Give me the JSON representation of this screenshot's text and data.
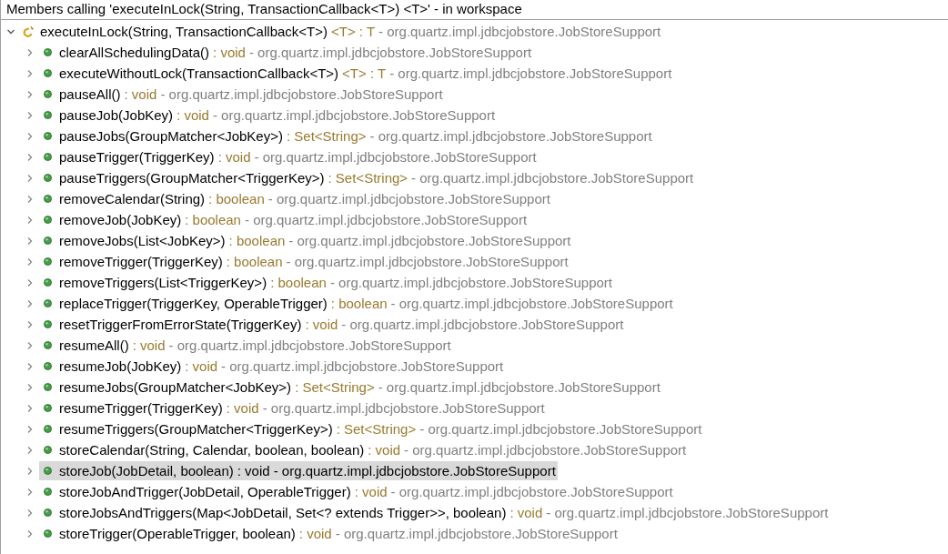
{
  "view": {
    "title": "Members calling 'executeInLock(String, TransactionCallback<T>) <T>' - in workspace"
  },
  "tree": {
    "root": {
      "kind": "generic",
      "name": "executeInLock(String, TransactionCallback<T>)",
      "return_type": "<T> : T",
      "declaring_type": "- org.quartz.impl.jdbcjobstore.JobStoreSupport",
      "expanded": true,
      "selected": false,
      "children": [
        {
          "kind": "public",
          "name": "clearAllSchedulingData()",
          "return_type": ": void",
          "declaring_type": "- org.quartz.impl.jdbcjobstore.JobStoreSupport",
          "expanded": false,
          "selected": false
        },
        {
          "kind": "public",
          "name": "executeWithoutLock(TransactionCallback<T>)",
          "return_type": "<T> : T",
          "declaring_type": "- org.quartz.impl.jdbcjobstore.JobStoreSupport",
          "expanded": false,
          "selected": false
        },
        {
          "kind": "public",
          "name": "pauseAll()",
          "return_type": ": void",
          "declaring_type": "- org.quartz.impl.jdbcjobstore.JobStoreSupport",
          "expanded": false,
          "selected": false
        },
        {
          "kind": "public",
          "name": "pauseJob(JobKey)",
          "return_type": ": void",
          "declaring_type": "- org.quartz.impl.jdbcjobstore.JobStoreSupport",
          "expanded": false,
          "selected": false
        },
        {
          "kind": "public",
          "name": "pauseJobs(GroupMatcher<JobKey>)",
          "return_type": ": Set<String>",
          "declaring_type": "- org.quartz.impl.jdbcjobstore.JobStoreSupport",
          "expanded": false,
          "selected": false
        },
        {
          "kind": "public",
          "name": "pauseTrigger(TriggerKey)",
          "return_type": ": void",
          "declaring_type": "- org.quartz.impl.jdbcjobstore.JobStoreSupport",
          "expanded": false,
          "selected": false
        },
        {
          "kind": "public",
          "name": "pauseTriggers(GroupMatcher<TriggerKey>)",
          "return_type": ": Set<String>",
          "declaring_type": "- org.quartz.impl.jdbcjobstore.JobStoreSupport",
          "expanded": false,
          "selected": false
        },
        {
          "kind": "public",
          "name": "removeCalendar(String)",
          "return_type": ": boolean",
          "declaring_type": "- org.quartz.impl.jdbcjobstore.JobStoreSupport",
          "expanded": false,
          "selected": false
        },
        {
          "kind": "public",
          "name": "removeJob(JobKey)",
          "return_type": ": boolean",
          "declaring_type": "- org.quartz.impl.jdbcjobstore.JobStoreSupport",
          "expanded": false,
          "selected": false
        },
        {
          "kind": "public",
          "name": "removeJobs(List<JobKey>)",
          "return_type": ": boolean",
          "declaring_type": "- org.quartz.impl.jdbcjobstore.JobStoreSupport",
          "expanded": false,
          "selected": false
        },
        {
          "kind": "public",
          "name": "removeTrigger(TriggerKey)",
          "return_type": ": boolean",
          "declaring_type": "- org.quartz.impl.jdbcjobstore.JobStoreSupport",
          "expanded": false,
          "selected": false
        },
        {
          "kind": "public",
          "name": "removeTriggers(List<TriggerKey>)",
          "return_type": ": boolean",
          "declaring_type": "- org.quartz.impl.jdbcjobstore.JobStoreSupport",
          "expanded": false,
          "selected": false
        },
        {
          "kind": "public",
          "name": "replaceTrigger(TriggerKey, OperableTrigger)",
          "return_type": ": boolean",
          "declaring_type": "- org.quartz.impl.jdbcjobstore.JobStoreSupport",
          "expanded": false,
          "selected": false
        },
        {
          "kind": "public",
          "name": "resetTriggerFromErrorState(TriggerKey)",
          "return_type": ": void",
          "declaring_type": "- org.quartz.impl.jdbcjobstore.JobStoreSupport",
          "expanded": false,
          "selected": false
        },
        {
          "kind": "public",
          "name": "resumeAll()",
          "return_type": ": void",
          "declaring_type": "- org.quartz.impl.jdbcjobstore.JobStoreSupport",
          "expanded": false,
          "selected": false
        },
        {
          "kind": "public",
          "name": "resumeJob(JobKey)",
          "return_type": ": void",
          "declaring_type": "- org.quartz.impl.jdbcjobstore.JobStoreSupport",
          "expanded": false,
          "selected": false
        },
        {
          "kind": "public",
          "name": "resumeJobs(GroupMatcher<JobKey>)",
          "return_type": ": Set<String>",
          "declaring_type": "- org.quartz.impl.jdbcjobstore.JobStoreSupport",
          "expanded": false,
          "selected": false
        },
        {
          "kind": "public",
          "name": "resumeTrigger(TriggerKey)",
          "return_type": ": void",
          "declaring_type": "- org.quartz.impl.jdbcjobstore.JobStoreSupport",
          "expanded": false,
          "selected": false
        },
        {
          "kind": "public",
          "name": "resumeTriggers(GroupMatcher<TriggerKey>)",
          "return_type": ": Set<String>",
          "declaring_type": "- org.quartz.impl.jdbcjobstore.JobStoreSupport",
          "expanded": false,
          "selected": false
        },
        {
          "kind": "public",
          "name": "storeCalendar(String, Calendar, boolean, boolean)",
          "return_type": ": void",
          "declaring_type": "- org.quartz.impl.jdbcjobstore.JobStoreSupport",
          "expanded": false,
          "selected": false
        },
        {
          "kind": "public",
          "name": "storeJob(JobDetail, boolean)",
          "return_type": ": void",
          "declaring_type": "- org.quartz.impl.jdbcjobstore.JobStoreSupport",
          "expanded": false,
          "selected": true
        },
        {
          "kind": "public",
          "name": "storeJobAndTrigger(JobDetail, OperableTrigger)",
          "return_type": ": void",
          "declaring_type": "- org.quartz.impl.jdbcjobstore.JobStoreSupport",
          "expanded": false,
          "selected": false
        },
        {
          "kind": "public",
          "name": "storeJobsAndTriggers(Map<JobDetail, Set<? extends Trigger>>, boolean)",
          "return_type": ": void",
          "declaring_type": "- org.quartz.impl.jdbcjobstore.JobStoreSupport",
          "expanded": false,
          "selected": false
        },
        {
          "kind": "public",
          "name": "storeTrigger(OperableTrigger, boolean)",
          "return_type": ": void",
          "declaring_type": "- org.quartz.impl.jdbcjobstore.JobStoreSupport",
          "expanded": false,
          "selected": false
        }
      ]
    }
  }
}
